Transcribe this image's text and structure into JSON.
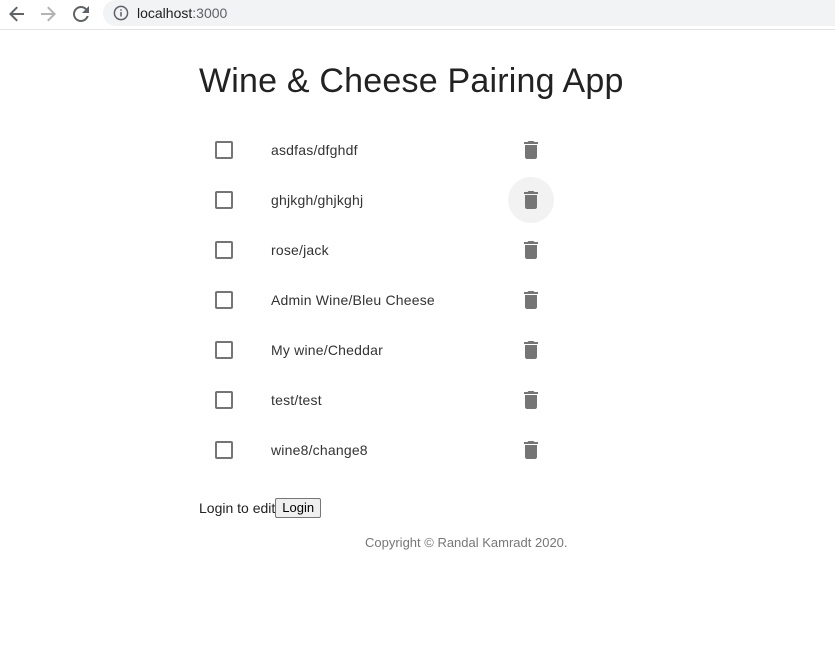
{
  "browser": {
    "url_host": "localhost",
    "url_port": ":3000",
    "icons": {
      "back": "arrow-left-icon",
      "forward": "arrow-right-icon",
      "reload": "reload-icon",
      "info": "info-icon"
    }
  },
  "app": {
    "title": "Wine & Cheese Pairing App",
    "pairings": [
      {
        "label": "asdfas/dfghdf"
      },
      {
        "label": "ghjkgh/ghjkghj"
      },
      {
        "label": "rose/jack"
      },
      {
        "label": "Admin Wine/Bleu Cheese"
      },
      {
        "label": "My wine/Cheddar"
      },
      {
        "label": "test/test"
      },
      {
        "label": "wine8/change8"
      }
    ],
    "login_prompt": "Login to edit",
    "login_button": "Login",
    "copyright": "Copyright © Randal Kamradt 2020."
  },
  "colors": {
    "icon_gray": "#757575",
    "hover_bg": "#f2f2f2"
  }
}
